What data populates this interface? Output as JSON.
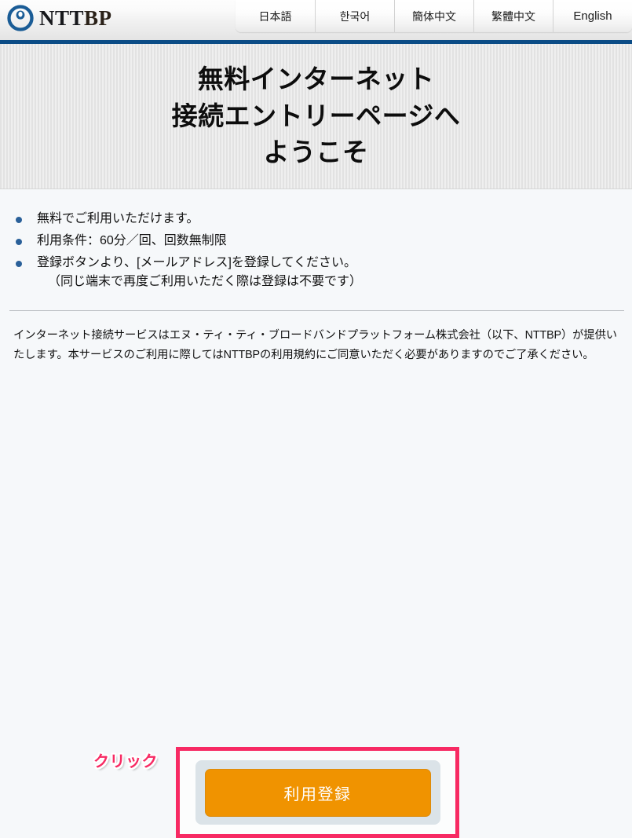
{
  "header": {
    "brand_name_dark": "NTT",
    "brand_name_light": "BP",
    "logo_icon": "nttbp-circle-logo-icon",
    "language_tabs": [
      {
        "label": "日本語",
        "script": "cjk"
      },
      {
        "label": "한국어",
        "script": "cjk"
      },
      {
        "label": "簡体中文",
        "script": "cjk"
      },
      {
        "label": "繁體中文",
        "script": "cjk"
      },
      {
        "label": "English",
        "script": "latin"
      }
    ]
  },
  "hero": {
    "line1": "無料インターネット",
    "line2": "接続エントリーページへ",
    "line3": "ようこそ"
  },
  "main": {
    "bullets": [
      {
        "text": "無料でご利用いただけます。",
        "sub": ""
      },
      {
        "text": "利用条件：60分／回、回数無制限",
        "sub": ""
      },
      {
        "text": "登録ボタンより、[メールアドレス]を登録してください。",
        "sub": "（同じ端末で再度ご利用いただく際は登録は不要です）"
      }
    ],
    "paragraph": "インターネット接続サービスはエヌ・ティ・ティ・ブロードバンドプラットフォーム株式会社（以下、NTTBP）が提供いたします。本サービスのご利用に際してはNTTBPの利用規約にご同意いただく必要がありますのでご了承ください。"
  },
  "cta": {
    "click_hint": "クリック",
    "button_label": "利用登録",
    "highlight_color": "#f72a63",
    "button_color": "#f09300",
    "panel_color": "#dbe3e8"
  },
  "colors": {
    "navy_rule": "#0b4c86",
    "bullet_dot": "#2a6099",
    "page_background": "#f6f8fa",
    "logo_blue": "#1a5c96"
  }
}
